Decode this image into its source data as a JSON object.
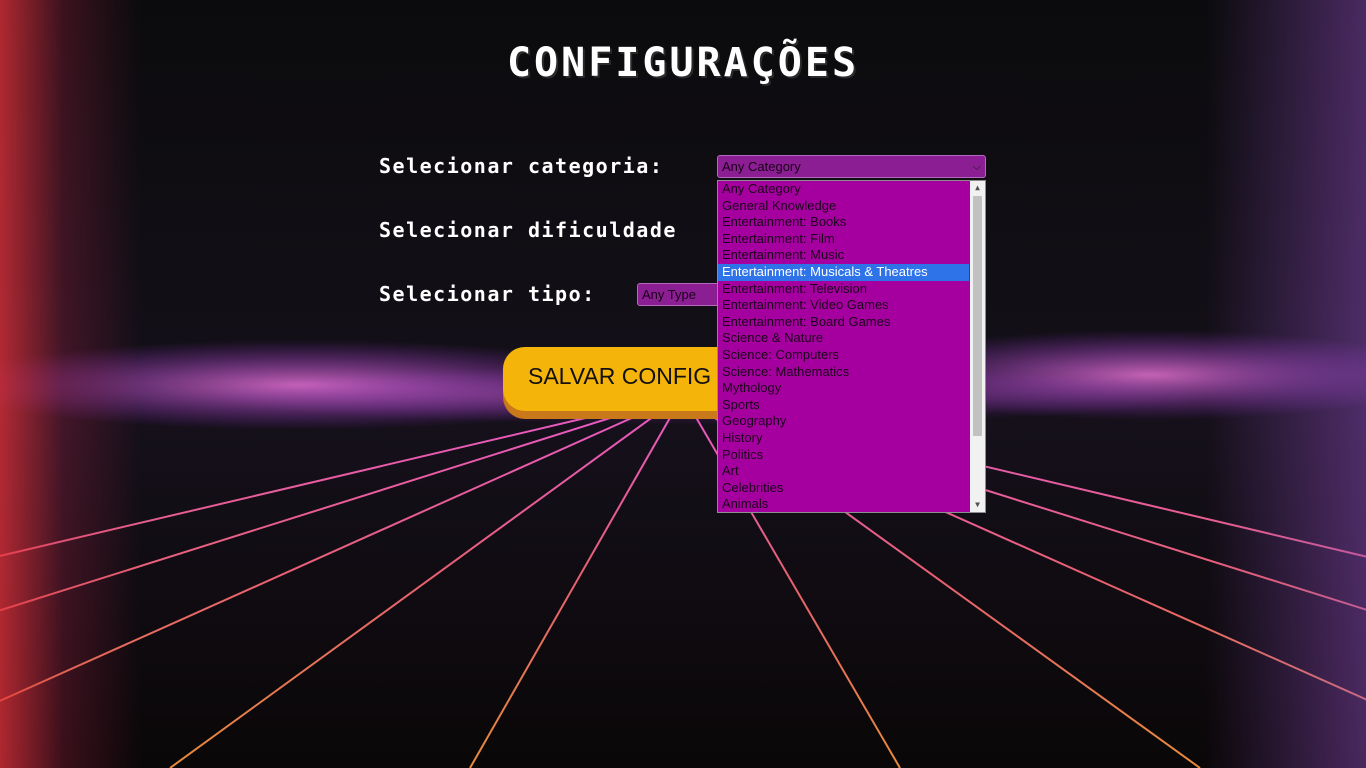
{
  "page": {
    "title": "CONFIGURAÇÕES"
  },
  "form": {
    "category_label": "Selecionar categoria:",
    "difficulty_label": "Selecionar dificuldade",
    "type_label": "Selecionar tipo:",
    "category_select": {
      "value": "Any Category",
      "options": [
        "Any Category",
        "General Knowledge",
        "Entertainment: Books",
        "Entertainment: Film",
        "Entertainment: Music",
        "Entertainment: Musicals & Theatres",
        "Entertainment: Television",
        "Entertainment: Video Games",
        "Entertainment: Board Games",
        "Science & Nature",
        "Science: Computers",
        "Science: Mathematics",
        "Mythology",
        "Sports",
        "Geography",
        "History",
        "Politics",
        "Art",
        "Celebrities",
        "Animals"
      ],
      "highlighted_option": "Entertainment: Musicals & Theatres"
    },
    "type_select": {
      "value": "Any Type"
    },
    "save_button_label": "SALVAR CONFIG"
  },
  "colors": {
    "select_bg": "#8b1e93",
    "dropdown_bg": "#a5009f",
    "highlight": "#2f73e8",
    "button": "#f5b40a"
  }
}
